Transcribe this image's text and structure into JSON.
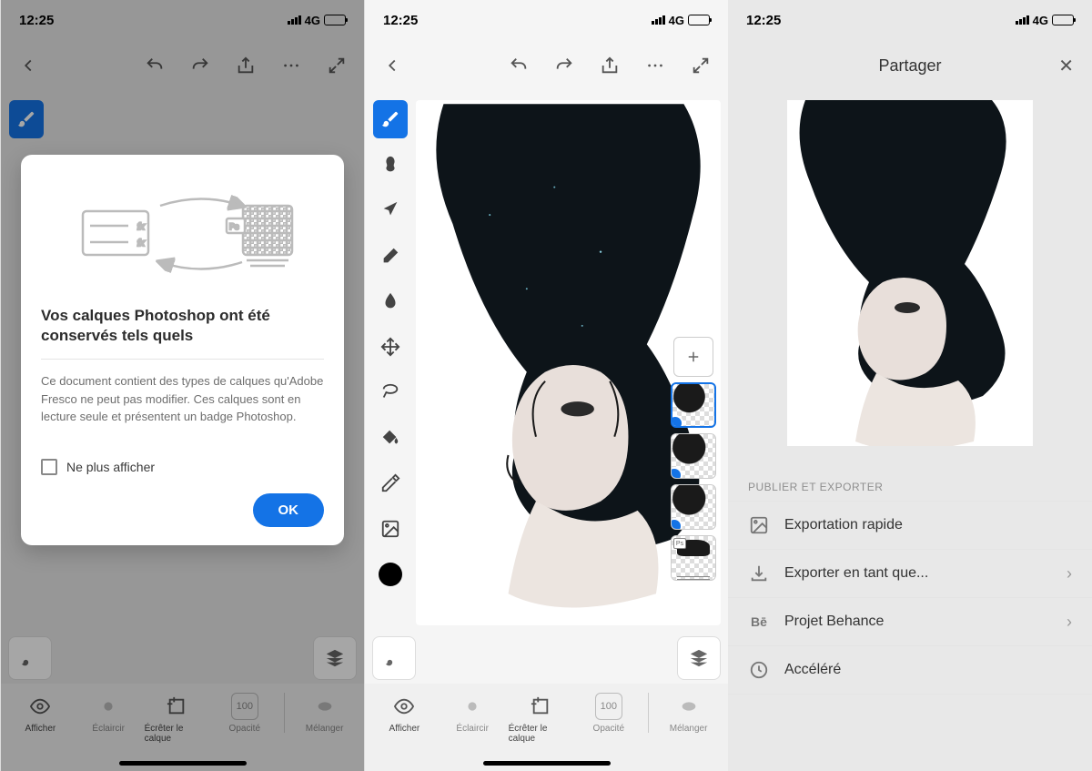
{
  "status": {
    "time": "12:25",
    "network": "4G"
  },
  "modal": {
    "title": "Vos calques Photoshop ont été conservés tels quels",
    "body": "Ce document contient des types de calques qu'Adobe Fresco ne peut pas modifier. Ces calques sont en lecture seule et présentent un badge Photoshop.",
    "dont_show": "Ne plus afficher",
    "ok": "OK",
    "ps_badge": "Ps"
  },
  "bottom": {
    "afficher": "Afficher",
    "eclaircir": "Éclaircir",
    "ecreter": "Écrêter le calque",
    "opacite": "Opacité",
    "opacite_val": "100",
    "melanger": "Mélanger"
  },
  "layers": {
    "ps_label": "Ps"
  },
  "share": {
    "title": "Partager",
    "section": "PUBLIER ET EXPORTER",
    "quick_export": "Exportation rapide",
    "export_as": "Exporter en tant que...",
    "behance": "Projet Behance",
    "behance_icon": "Bē",
    "timelapse": "Accéléré"
  }
}
